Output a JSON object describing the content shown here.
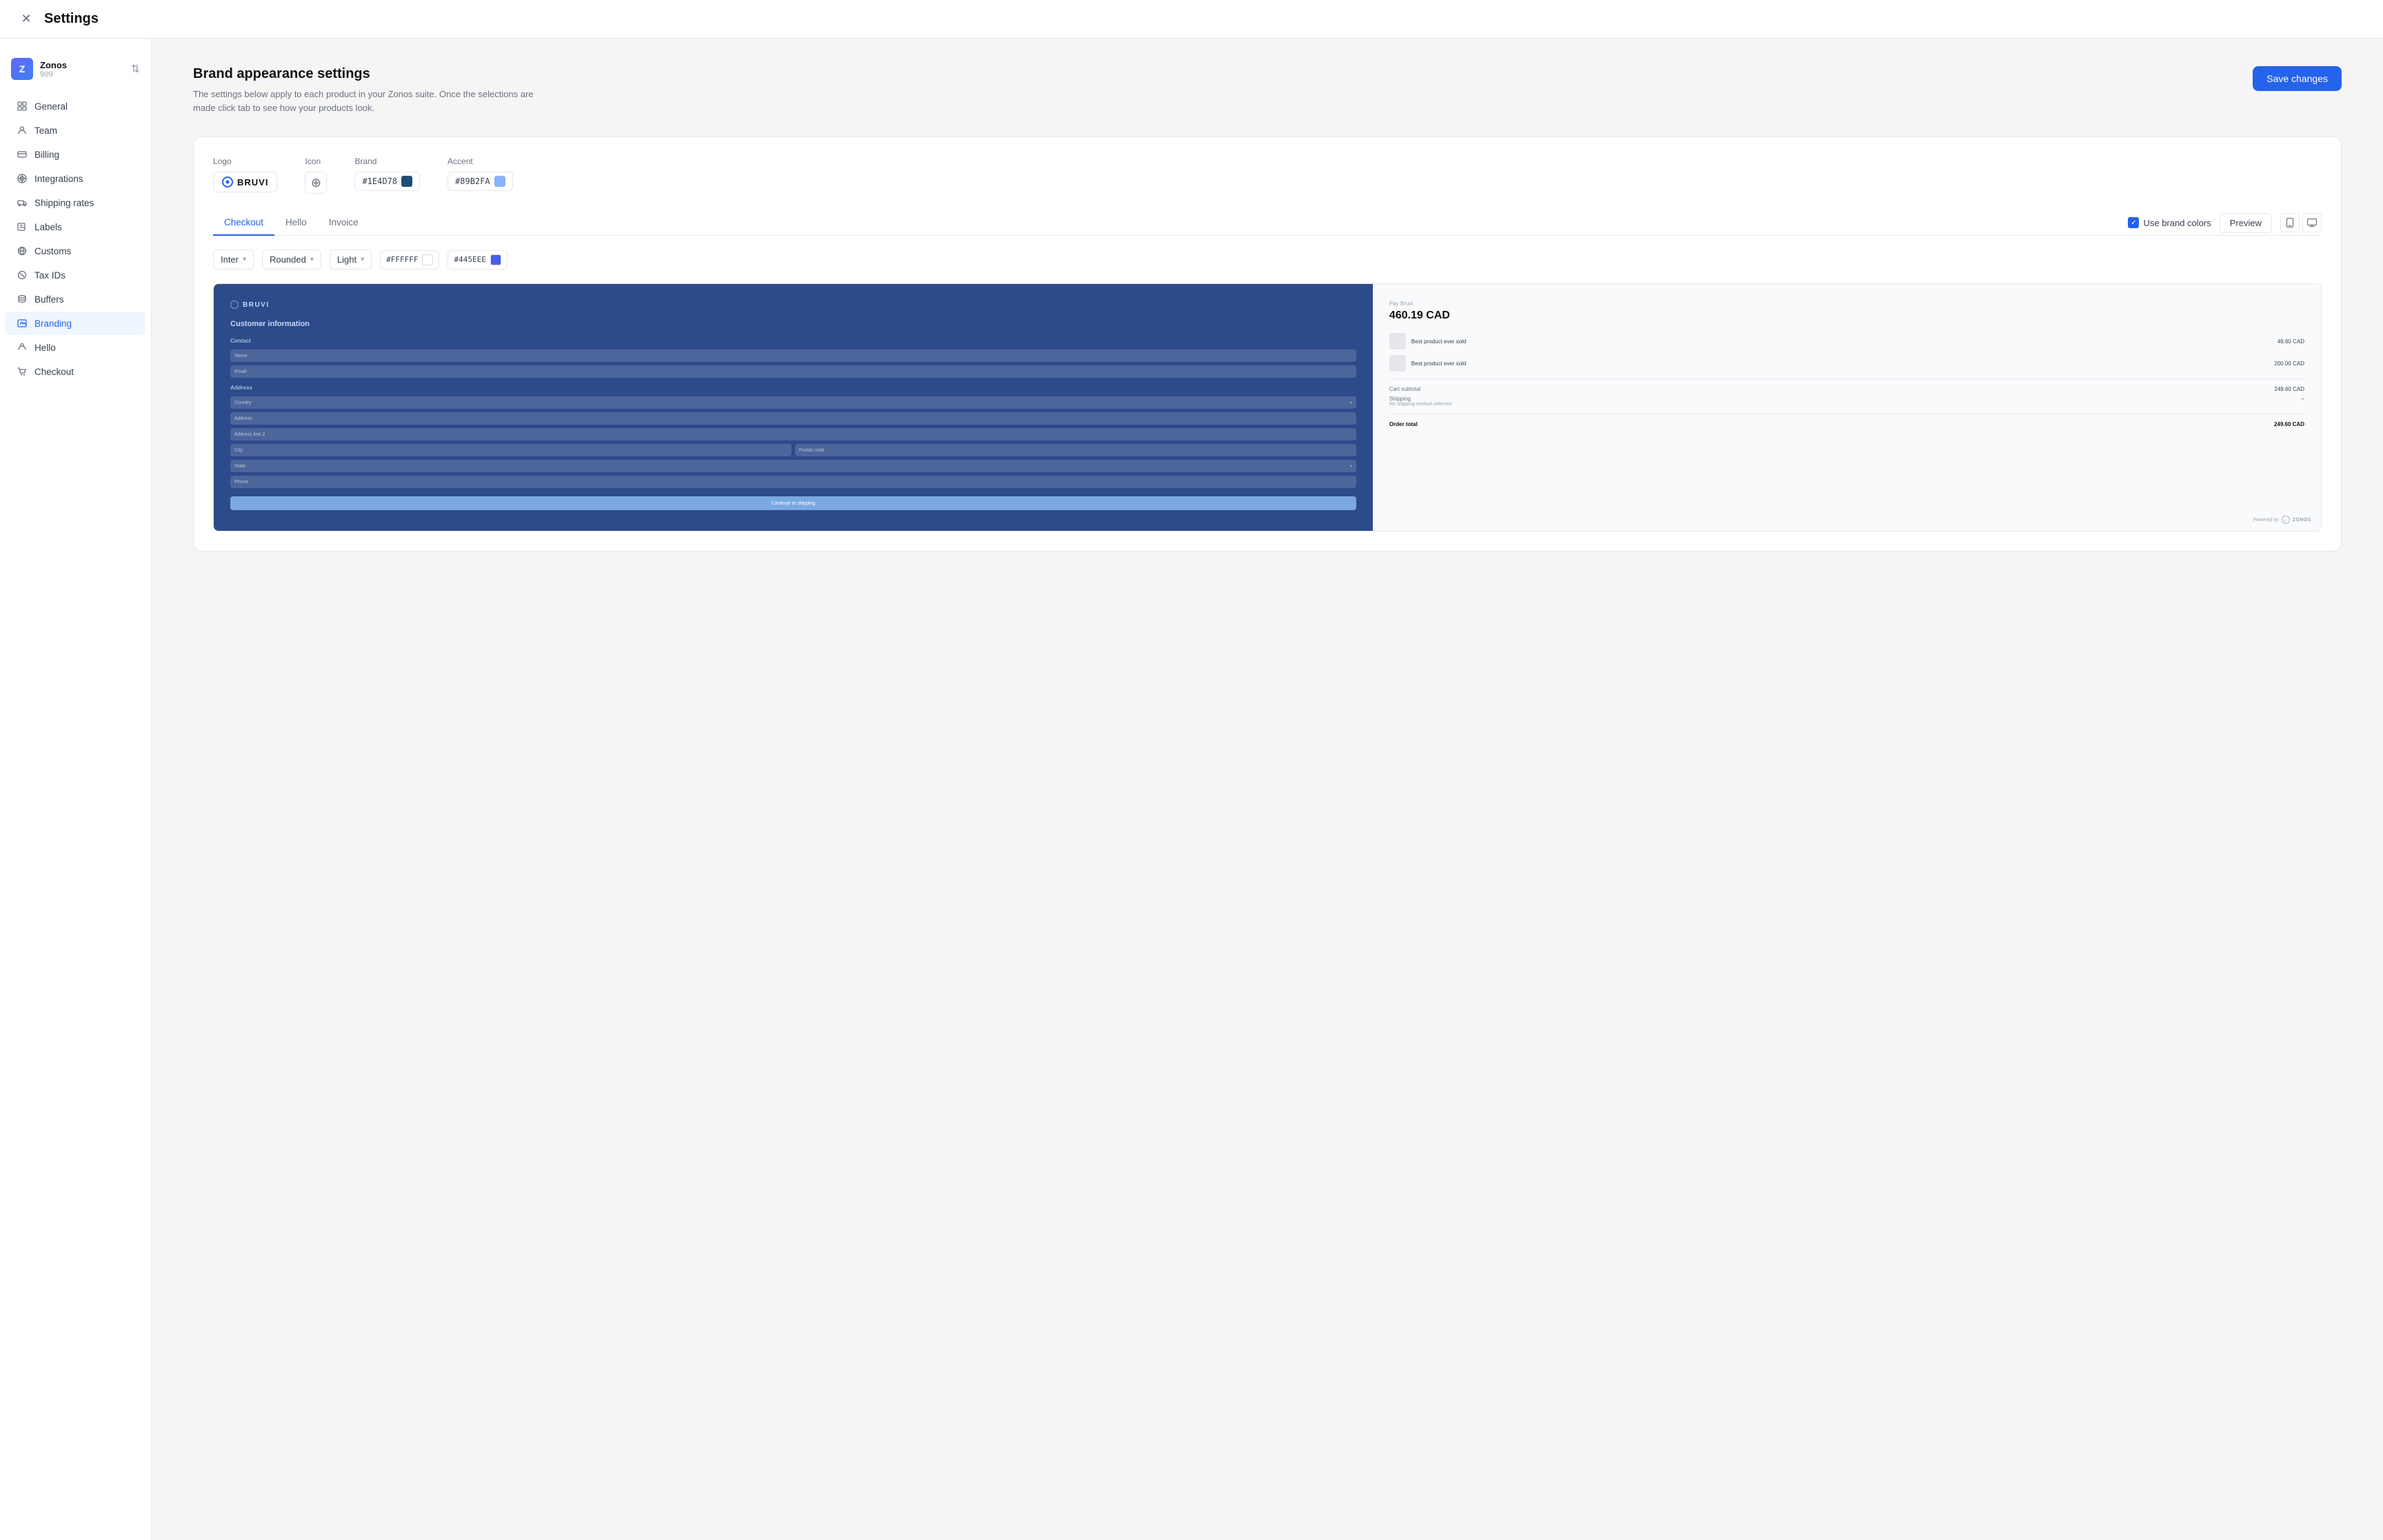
{
  "header": {
    "title": "Settings",
    "close_label": "×"
  },
  "sidebar": {
    "org": {
      "name": "Zonos",
      "id": "909",
      "avatar_letter": "Z"
    },
    "nav_items": [
      {
        "id": "general",
        "label": "General",
        "icon": "grid"
      },
      {
        "id": "team",
        "label": "Team",
        "icon": "user"
      },
      {
        "id": "billing",
        "label": "Billing",
        "icon": "credit-card"
      },
      {
        "id": "integrations",
        "label": "Integrations",
        "icon": "settings"
      },
      {
        "id": "shipping-rates",
        "label": "Shipping rates",
        "icon": "truck"
      },
      {
        "id": "labels",
        "label": "Labels",
        "icon": "tag"
      },
      {
        "id": "customs",
        "label": "Customs",
        "icon": "globe"
      },
      {
        "id": "tax-ids",
        "label": "Tax IDs",
        "icon": "globe2"
      },
      {
        "id": "buffers",
        "label": "Buffers",
        "icon": "layers"
      },
      {
        "id": "branding",
        "label": "Branding",
        "icon": "image",
        "active": true
      },
      {
        "id": "hello",
        "label": "Hello",
        "icon": "star"
      },
      {
        "id": "checkout",
        "label": "Checkout",
        "icon": "shopping-bag"
      }
    ]
  },
  "main": {
    "title": "Brand appearance settings",
    "description": "The settings below apply to each product in your Zonos suite. Once the selections are made click tab to see how your products look.",
    "save_button": "Save changes",
    "logo_label": "Logo",
    "icon_label": "Icon",
    "brand_label": "Brand",
    "accent_label": "Accent",
    "logo_text": "BRUVI",
    "brand_color": "#1E4D78",
    "accent_color": "#89B2FA",
    "tabs": [
      {
        "id": "checkout",
        "label": "Checkout",
        "active": true
      },
      {
        "id": "hello",
        "label": "Hello"
      },
      {
        "id": "invoice",
        "label": "Invoice"
      }
    ],
    "use_brand_colors_label": "Use brand colors",
    "preview_button": "Preview",
    "toolbar": {
      "font": "Inter",
      "border_radius": "Rounded",
      "theme": "Light",
      "bg_color": "#FFFFFF",
      "accent_color_2": "#445EEE"
    },
    "preview": {
      "checkout": {
        "logo_text": "BRUVI",
        "heading": "Customer information",
        "contact_label": "Contact",
        "name_placeholder": "Name",
        "email_placeholder": "Email",
        "address_label": "Address",
        "country_placeholder": "Country",
        "address_placeholder": "Address",
        "address2_placeholder": "Address line 2",
        "city_placeholder": "City",
        "postal_placeholder": "Postal code",
        "state_placeholder": "State",
        "phone_placeholder": "Phone",
        "continue_button": "Continue to shipping"
      },
      "order": {
        "brand_label": "Pay Bruvi",
        "total": "460.19 CAD",
        "items": [
          {
            "name": "Best product ever sold",
            "price": "49.60 CAD"
          },
          {
            "name": "Best product ever sold",
            "price": "200.00 CAD"
          }
        ],
        "cart_subtotal_label": "Cart subtotal",
        "cart_subtotal": "249.60 CAD",
        "shipping_label": "Shipping",
        "shipping_value": "–",
        "no_shipping_method": "No shipping method selected",
        "order_total_label": "Order total",
        "order_total": "249.60 CAD",
        "powered_by": "Powered by",
        "zonos": "ZONOS"
      }
    }
  }
}
